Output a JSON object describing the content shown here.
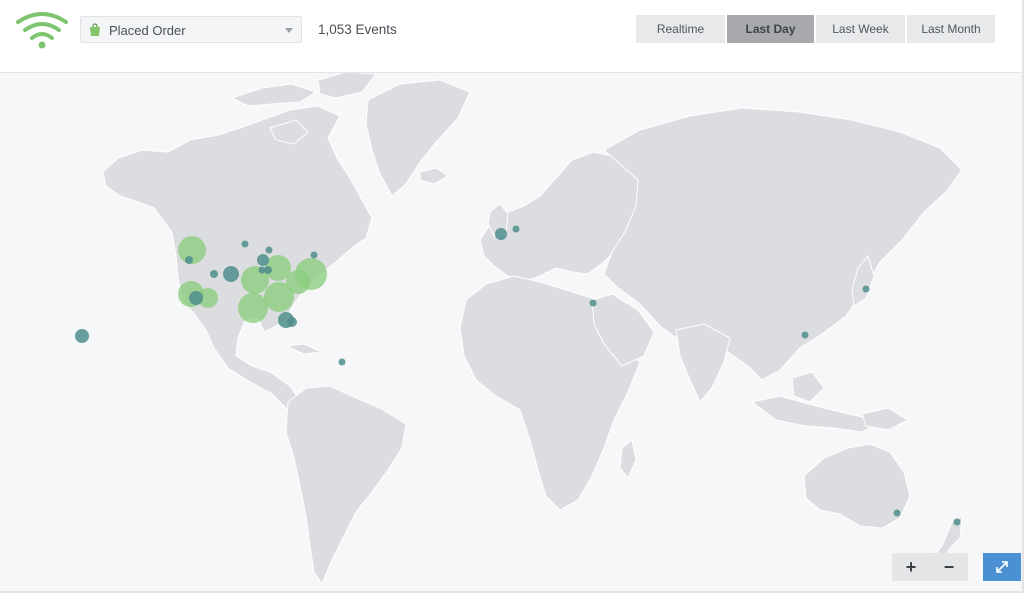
{
  "header": {
    "event_select": {
      "value": "Placed Order",
      "icon": "shopping-bag-icon"
    },
    "events_count": "1,053 Events",
    "time_ranges": [
      {
        "label": "Realtime",
        "active": false
      },
      {
        "label": "Last Day",
        "active": true
      },
      {
        "label": "Last Week",
        "active": false
      },
      {
        "label": "Last Month",
        "active": false
      }
    ]
  },
  "map": {
    "land_color": "#dcdde1",
    "ocean_color": "#f6f7f8",
    "marker_colors": {
      "large": "#8cce80",
      "small": "#4f8e8c"
    },
    "controls": {
      "zoom_in": "+",
      "zoom_out": "−",
      "fullscreen_icon": "expand-icon"
    }
  },
  "colors": {
    "brand": "#6dbb5f",
    "active_tab": "#a7a9ad",
    "accent": "#4a90d2"
  }
}
